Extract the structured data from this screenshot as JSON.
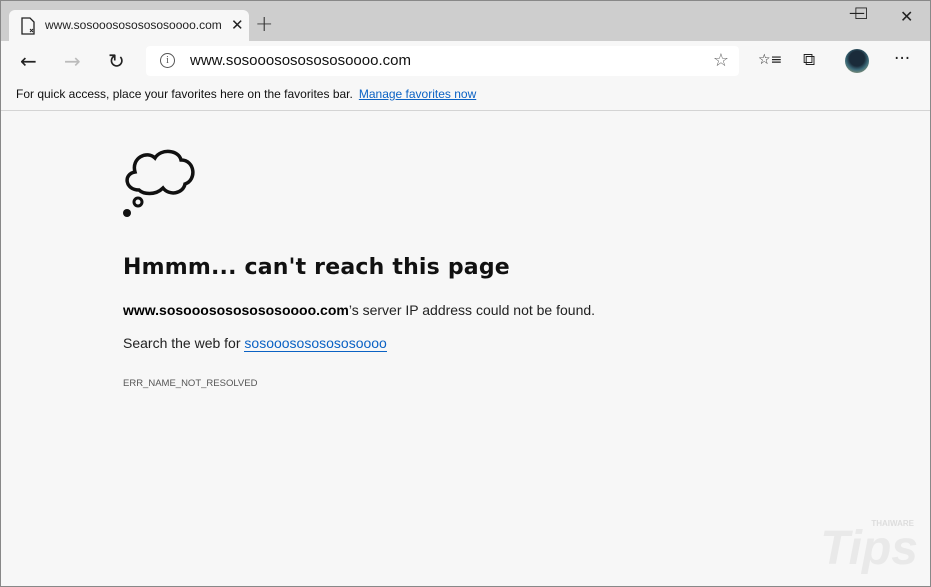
{
  "tab": {
    "title": "www.sosooosososososoooo.com",
    "close": "✕",
    "new_tab": "+"
  },
  "window": {
    "minimize": "—",
    "maximize": "☐",
    "close": "✕"
  },
  "nav": {
    "back": "←",
    "forward": "→",
    "refresh": "↻"
  },
  "address": {
    "info": "i",
    "url": "www.sosooosososososoooo.com",
    "star": "☆"
  },
  "toolbar": {
    "favorites": "☆≡",
    "collections": "⧉",
    "more": "···"
  },
  "favbar": {
    "text": "For quick access, place your favorites here on the favorites bar.",
    "link": "Manage favorites now"
  },
  "error": {
    "heading": "Hmmm... can't reach this page",
    "host": "www.sosooosososososoooo.com",
    "message": "’s server IP address could not be found.",
    "search_prefix": "Search the web for ",
    "search_term": "sosooosososososoooo",
    "code": "ERR_NAME_NOT_RESOLVED"
  },
  "watermark": {
    "text": "Tips",
    "sub": "THAIWARE"
  }
}
